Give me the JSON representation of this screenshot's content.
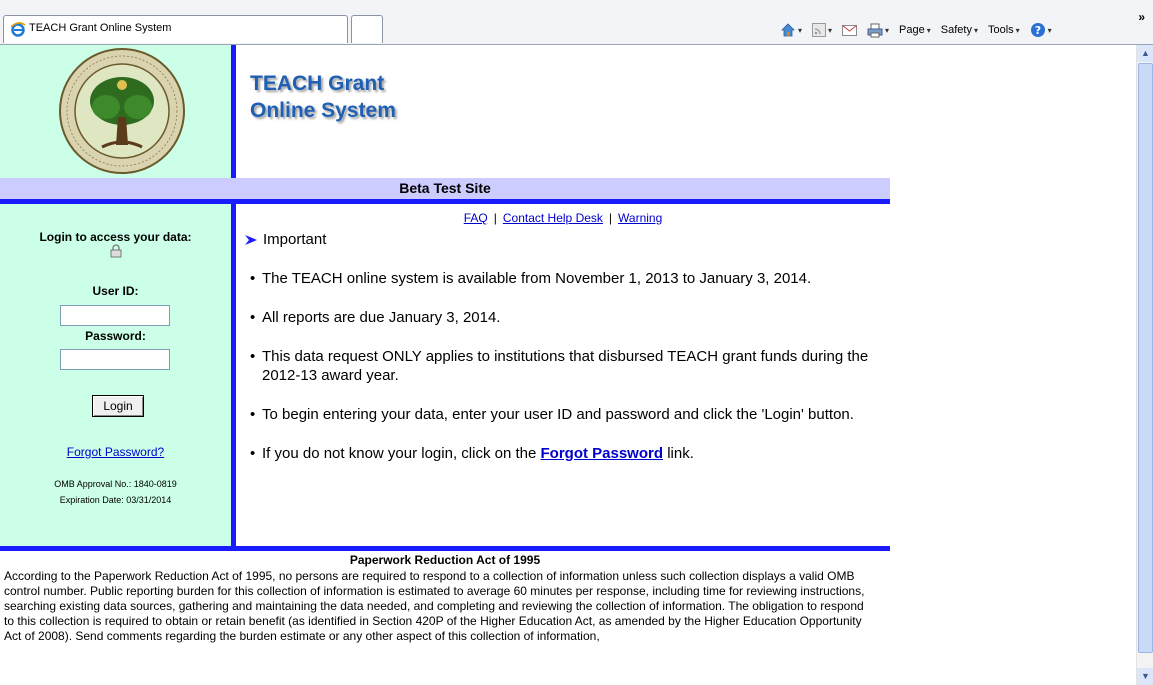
{
  "browser": {
    "tab_title": "TEACH Grant Online System",
    "commands": {
      "page": "Page",
      "safety": "Safety",
      "tools": "Tools"
    },
    "overflow": "»",
    "icons": [
      "ie-icon",
      "home-icon",
      "feeds-icon",
      "mail-icon",
      "print-icon",
      "help-icon"
    ]
  },
  "header": {
    "title_line1": "TEACH Grant",
    "title_line2": "Online System",
    "beta_label": "Beta Test Site"
  },
  "login": {
    "heading": "Login to access your data:",
    "user_id_label": "User ID:",
    "user_id_value": "",
    "password_label": "Password:",
    "password_value": "",
    "button_label": "Login",
    "forgot_link": "Forgot Password?",
    "omb_number": "OMB Approval No.: 1840-0819",
    "expiration": "Expiration Date: 03/31/2014"
  },
  "links": {
    "faq": "FAQ",
    "separator": "|",
    "contact": "Contact Help Desk",
    "warning": "Warning"
  },
  "important": {
    "heading": "Important",
    "bullets": [
      "The TEACH online system is available from November 1, 2013 to January 3, 2014.",
      "All reports are due January 3, 2014.",
      "This data request ONLY applies to institutions that disbursed TEACH grant funds during the 2012-13 award year.",
      "To begin entering your data, enter your user ID and password and click the 'Login' button."
    ],
    "last_bullet_pre": "If you do not know your login, click on the",
    "last_bullet_link": "Forgot Password",
    "last_bullet_post": "link."
  },
  "paperwork": {
    "title": "Paperwork Reduction Act of 1995",
    "text": "According to the Paperwork Reduction Act of 1995, no persons are required to respond to a collection of information unless such collection displays a valid OMB control number. Public reporting burden for this collection of information is estimated to average 60 minutes per response, including time for reviewing instructions, searching existing data sources, gathering and maintaining the data needed, and completing and reviewing the collection of information. The obligation to respond to this collection is required to obtain or retain benefit (as identified in Section 420P of the Higher Education Act, as amended by the Higher Education Opportunity Act of 2008). Send comments regarding the burden estimate or any other aspect of this collection of information,"
  },
  "colors": {
    "accent_blue": "#1a1aff",
    "mint": "#ccffe8",
    "lavender": "#ccccff",
    "title_blue": "#1f5fb4",
    "link": "#0000cc"
  }
}
